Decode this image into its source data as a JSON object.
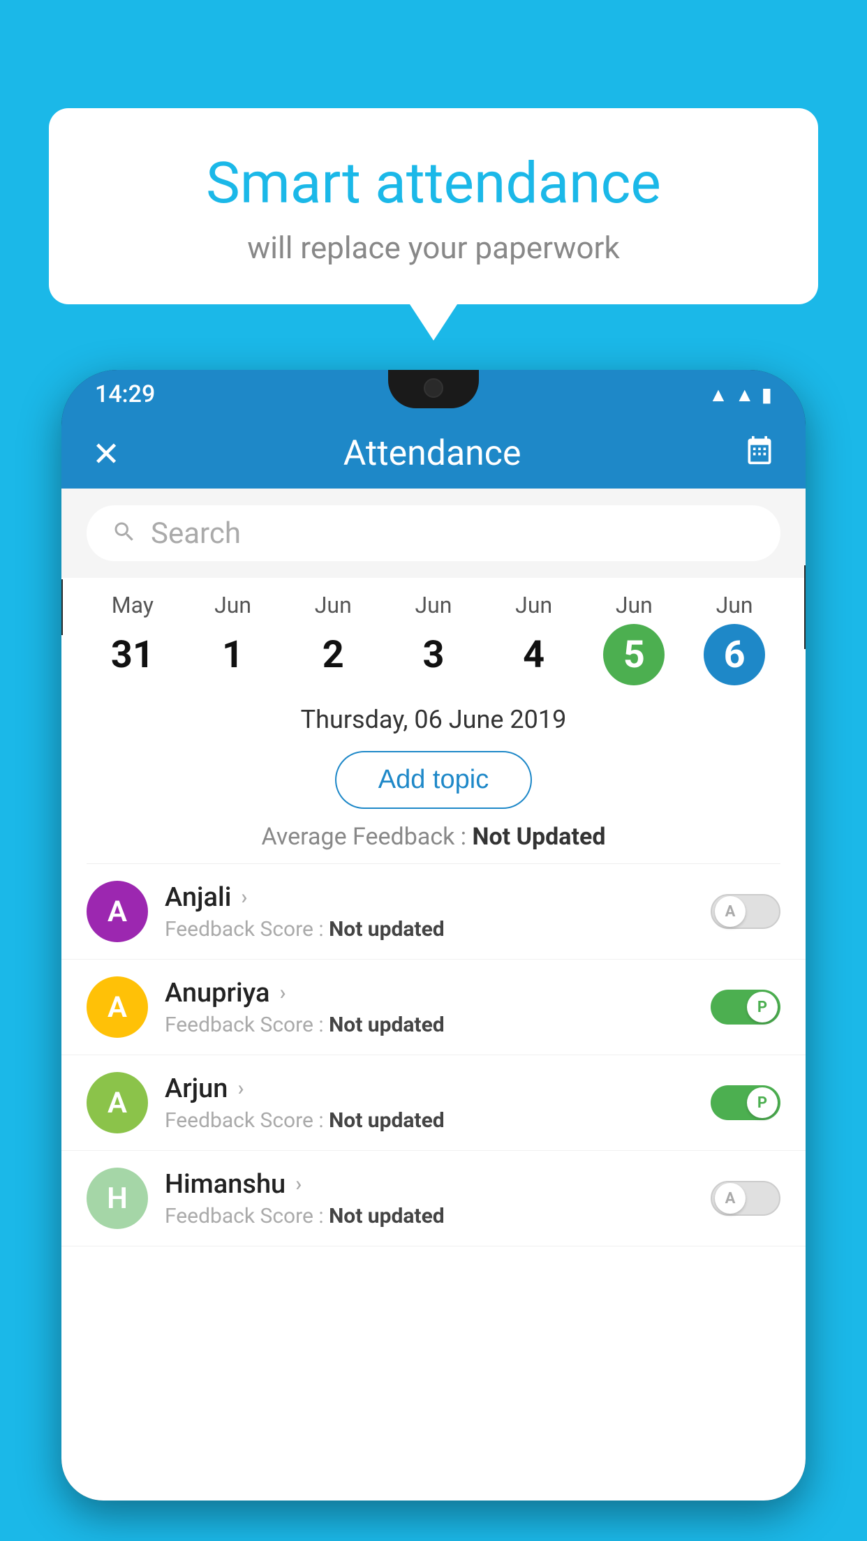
{
  "background_color": "#1bb8e8",
  "bubble": {
    "title": "Smart attendance",
    "subtitle": "will replace your paperwork"
  },
  "phone": {
    "status_bar": {
      "time": "14:29",
      "icons": [
        "wifi",
        "signal",
        "battery"
      ]
    },
    "header": {
      "close_label": "✕",
      "title": "Attendance",
      "calendar_icon": "📅"
    },
    "search": {
      "placeholder": "Search"
    },
    "dates": [
      {
        "month": "May",
        "day": "31",
        "state": "normal"
      },
      {
        "month": "Jun",
        "day": "1",
        "state": "normal"
      },
      {
        "month": "Jun",
        "day": "2",
        "state": "normal"
      },
      {
        "month": "Jun",
        "day": "3",
        "state": "normal"
      },
      {
        "month": "Jun",
        "day": "4",
        "state": "normal"
      },
      {
        "month": "Jun",
        "day": "5",
        "state": "today"
      },
      {
        "month": "Jun",
        "day": "6",
        "state": "selected"
      }
    ],
    "selected_date": "Thursday, 06 June 2019",
    "add_topic_label": "Add topic",
    "average_feedback_label": "Average Feedback : ",
    "average_feedback_value": "Not Updated",
    "students": [
      {
        "name": "Anjali",
        "avatar_color": "#9c27b0",
        "avatar_letter": "A",
        "feedback_label": "Feedback Score : ",
        "feedback_value": "Not updated",
        "toggle_state": "off",
        "toggle_letter": "A"
      },
      {
        "name": "Anupriya",
        "avatar_color": "#ffc107",
        "avatar_letter": "A",
        "feedback_label": "Feedback Score : ",
        "feedback_value": "Not updated",
        "toggle_state": "on",
        "toggle_letter": "P"
      },
      {
        "name": "Arjun",
        "avatar_color": "#8bc34a",
        "avatar_letter": "A",
        "feedback_label": "Feedback Score : ",
        "feedback_value": "Not updated",
        "toggle_state": "on",
        "toggle_letter": "P"
      },
      {
        "name": "Himanshu",
        "avatar_color": "#a5d6a7",
        "avatar_letter": "H",
        "feedback_label": "Feedback Score : ",
        "feedback_value": "Not updated",
        "toggle_state": "off",
        "toggle_letter": "A"
      }
    ]
  }
}
